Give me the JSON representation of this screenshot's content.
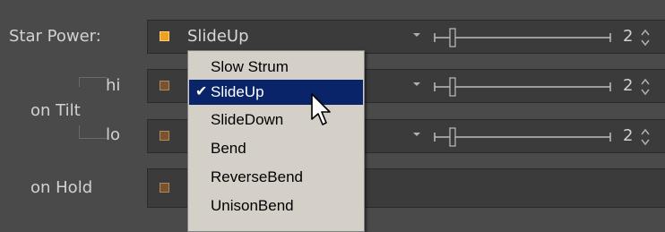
{
  "labels": {
    "star_power": "Star Power:",
    "on_tilt": "on Tilt",
    "hi": "hi",
    "lo": "lo",
    "on_hold": "on Hold"
  },
  "rows": {
    "star_power": {
      "selected": "SlideUp",
      "value": "2",
      "slider_level": 0.1
    },
    "tilt_hi": {
      "value": "2",
      "slider_level": 0.1
    },
    "tilt_lo": {
      "value": "2",
      "slider_level": 0.1
    }
  },
  "dropdown": {
    "items": [
      "Slow Strum",
      "SlideUp",
      "SlideDown",
      "Bend",
      "ReverseBend",
      "UnisonBend"
    ],
    "selected_index": 1,
    "check_glyph": "✔"
  },
  "colors": {
    "accent_on": "#f0a020",
    "accent_off": "#7a5230",
    "menu_highlight": "#0a246a"
  }
}
